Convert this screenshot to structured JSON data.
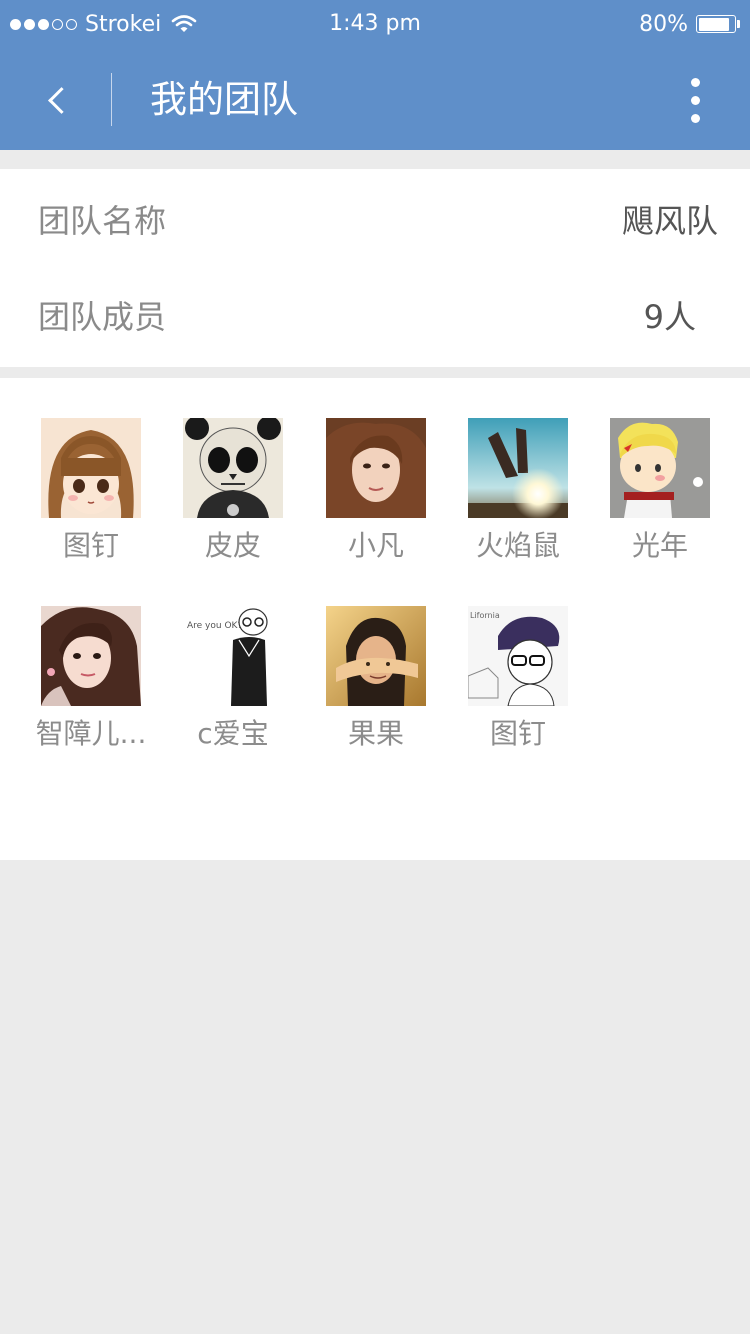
{
  "status": {
    "carrier": "Strokei",
    "time": "1:43 pm",
    "battery": "80%",
    "battery_level": 0.8
  },
  "nav": {
    "title": "我的团队",
    "back_icon": "chevron-left-icon",
    "more_icon": "more-vertical-icon"
  },
  "info": {
    "team_name_label": "团队名称",
    "team_name_value": "飓风队",
    "members_label": "团队成员",
    "members_value": "9人"
  },
  "members": [
    {
      "name": "图钉",
      "avatar": "cartoon-girl"
    },
    {
      "name": "皮皮",
      "avatar": "panda-skull"
    },
    {
      "name": "小凡",
      "avatar": "girl-photo"
    },
    {
      "name": "火焰鼠",
      "avatar": "hand-sunset"
    },
    {
      "name": "光年",
      "avatar": "cartoon-boy"
    },
    {
      "name": "智障儿...",
      "avatar": "girl-photo-2"
    },
    {
      "name": "c爱宝",
      "avatar": "sketch-boy"
    },
    {
      "name": "果果",
      "avatar": "hand-face"
    },
    {
      "name": "图钉",
      "avatar": "sketch-cap"
    }
  ],
  "colors": {
    "header": "#5f8fc9",
    "background": "#ebebeb"
  }
}
